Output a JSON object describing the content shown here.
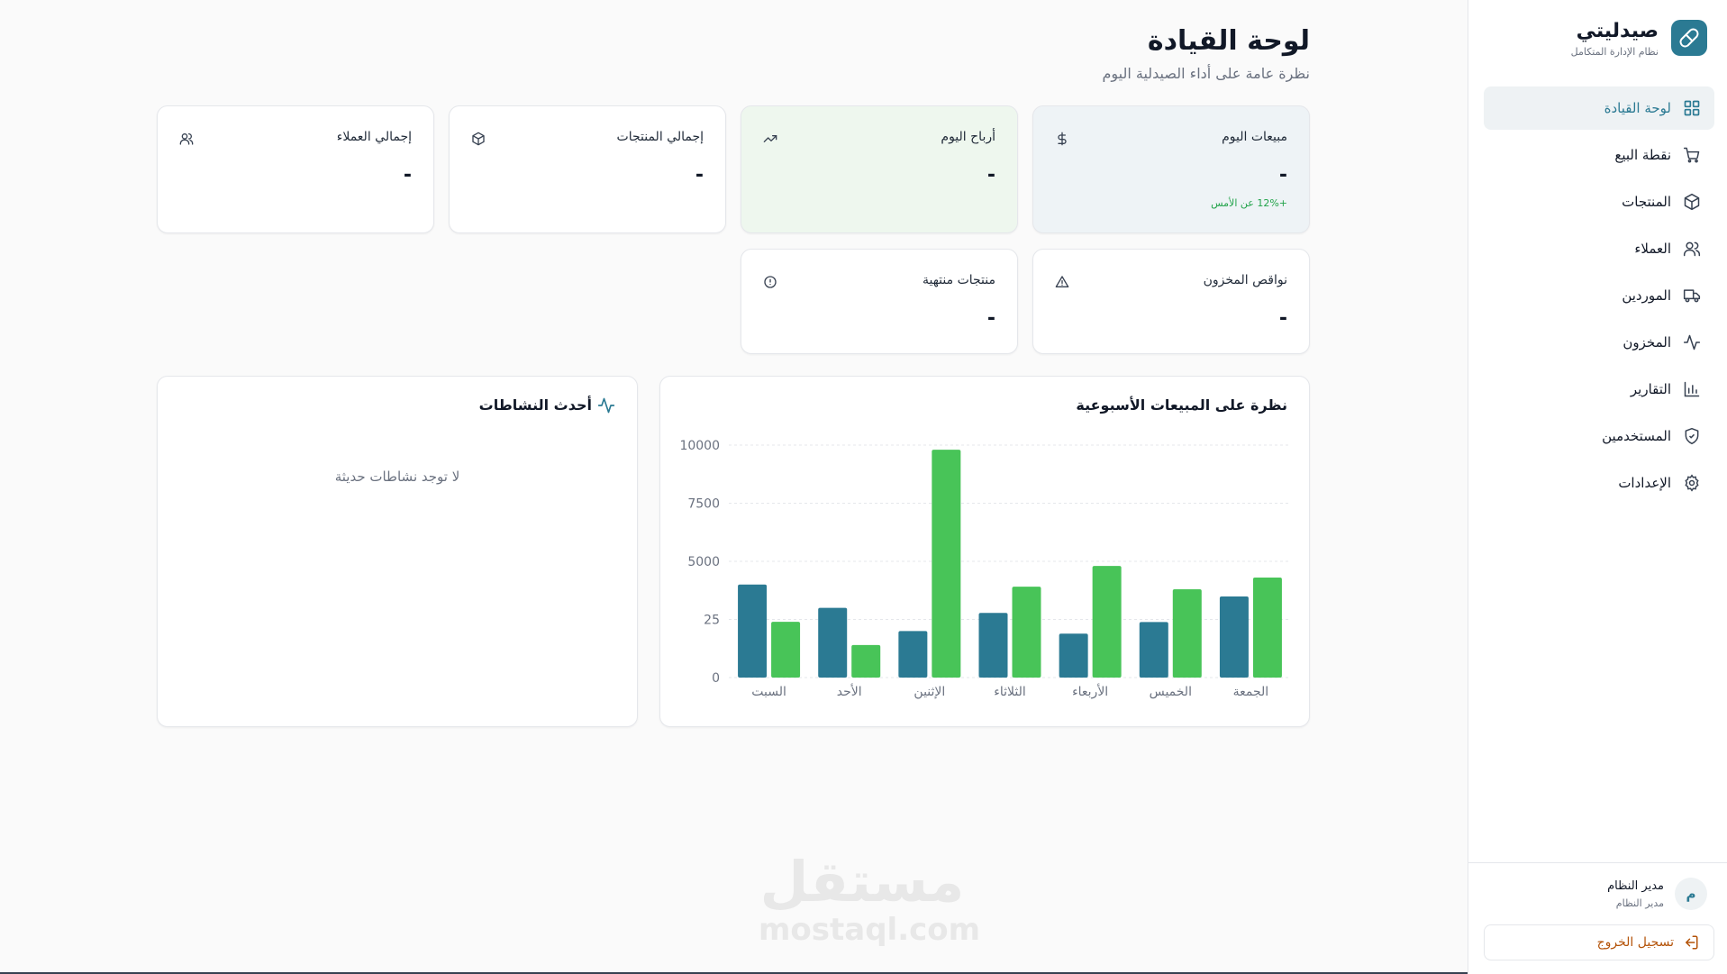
{
  "brand": {
    "name": "صيدليتي",
    "subtitle": "نظام الإدارة المتكامل"
  },
  "nav": [
    {
      "id": "dashboard",
      "label": "لوحة القيادة",
      "icon": "grid-icon",
      "active": true
    },
    {
      "id": "pos",
      "label": "نقطة البيع",
      "icon": "cart-icon"
    },
    {
      "id": "products",
      "label": "المنتجات",
      "icon": "box-icon"
    },
    {
      "id": "customers",
      "label": "العملاء",
      "icon": "users-icon"
    },
    {
      "id": "suppliers",
      "label": "الموردين",
      "icon": "truck-icon"
    },
    {
      "id": "inventory",
      "label": "المخزون",
      "icon": "activity-icon"
    },
    {
      "id": "reports",
      "label": "التقارير",
      "icon": "bar-chart-icon"
    },
    {
      "id": "users",
      "label": "المستخدمين",
      "icon": "shield-icon"
    },
    {
      "id": "settings",
      "label": "الإعدادات",
      "icon": "gear-icon"
    }
  ],
  "user": {
    "initial": "م",
    "name": "مدير النظام",
    "role": "مدير النظام"
  },
  "logout_label": "تسجيل الخروج",
  "header": {
    "title": "لوحة القيادة",
    "subtitle": "نظرة عامة على أداء الصيدلية اليوم"
  },
  "stats": {
    "sales_today": {
      "label": "مبيعات اليوم",
      "value": "-",
      "trend": "+12% عن الأمس",
      "icon": "dollar-icon"
    },
    "profit_today": {
      "label": "أرباح اليوم",
      "value": "-",
      "icon": "trending-up-icon"
    },
    "total_products": {
      "label": "إجمالي المنتجات",
      "value": "-",
      "icon": "box-icon"
    },
    "total_customers": {
      "label": "إجمالي العملاء",
      "value": "-",
      "icon": "users-icon"
    },
    "low_stock": {
      "label": "نواقص المخزون",
      "value": "-",
      "icon": "alert-triangle-icon"
    },
    "expired": {
      "label": "منتجات منتهية",
      "value": "-",
      "icon": "alert-circle-icon"
    }
  },
  "chart_title": "نظرة على المبيعات الأسبوعية",
  "chart_data": {
    "type": "bar",
    "categories": [
      "السبت",
      "الأحد",
      "الإثنين",
      "الثلاثاء",
      "الأربعاء",
      "الخميس",
      "الجمعة"
    ],
    "series": [
      {
        "values": [
          4000,
          3000,
          2000,
          2780,
          1890,
          2390,
          3490
        ],
        "color": "#2b7a93"
      },
      {
        "values": [
          2400,
          1398,
          9800,
          3908,
          4800,
          3800,
          4300
        ],
        "color": "#48c458"
      }
    ],
    "yticks": [
      "0",
      "25",
      "5000",
      "7500",
      "10000"
    ],
    "ylim": [
      0,
      10000
    ],
    "grid": true
  },
  "activity": {
    "title": "أحدث النشاطات",
    "empty": "لا توجد نشاطات حديثة"
  },
  "watermark": {
    "ar": "مستقل",
    "en": "mostaql.com"
  },
  "colors": {
    "primary": "#2b7a93",
    "accent": "#48c458",
    "logout": "#b45309"
  }
}
